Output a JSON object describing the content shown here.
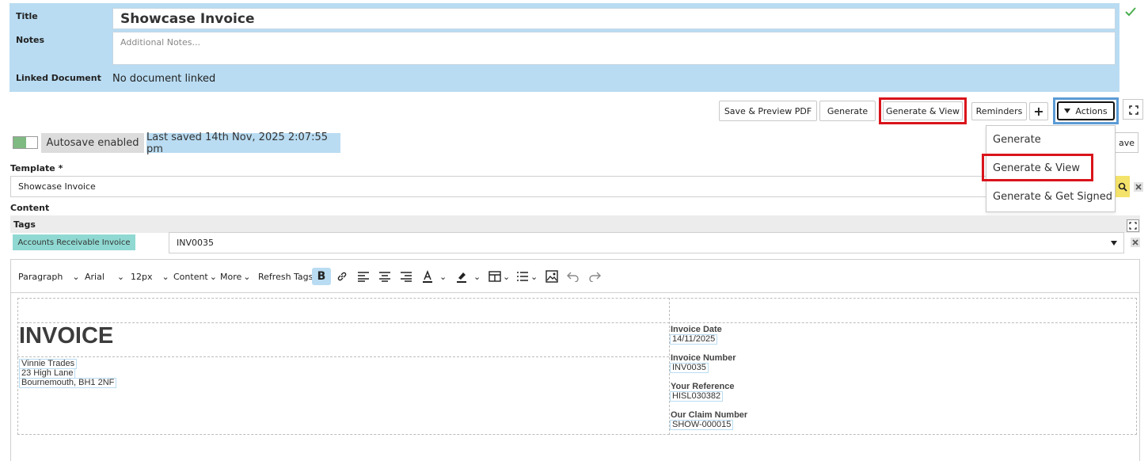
{
  "header": {
    "title_label": "Title",
    "title_value": "Showcase Invoice",
    "notes_label": "Notes",
    "notes_placeholder": "Additional Notes...",
    "linked_label": "Linked Document",
    "linked_value": "No document linked"
  },
  "toolbar": {
    "save_preview": "Save & Preview PDF",
    "generate": "Generate",
    "generate_view": "Generate & View",
    "reminders": "Reminders",
    "plus": "+",
    "actions": "Actions",
    "save_partial": "ave"
  },
  "autosave": {
    "label": "Autosave enabled",
    "last_saved": "Last saved 14th Nov, 2025 2:07:55 pm"
  },
  "actions_menu": {
    "items": [
      "Generate",
      "Generate & View",
      "Generate & Get Signed"
    ]
  },
  "template": {
    "label": "Template *",
    "value": "Showcase Invoice"
  },
  "content": {
    "label": "Content"
  },
  "tags": {
    "label": "Tags",
    "chip": "Accounts Receivable Invoice",
    "value": "INV0035"
  },
  "editor_toolbar": {
    "paragraph": "Paragraph",
    "font": "Arial",
    "size": "12px",
    "content": "Content",
    "more": "More",
    "refresh": "Refresh Tags",
    "bold": "B"
  },
  "document": {
    "title": "INVOICE",
    "address": [
      "Vinnie Trades",
      "23 High Lane",
      "Bournemouth, BH1 2NF"
    ],
    "fields": [
      {
        "label": "Invoice Date",
        "value": "14/11/2025"
      },
      {
        "label": "Invoice Number",
        "value": "INV0035"
      },
      {
        "label": "Your Reference",
        "value": "HISL030382"
      },
      {
        "label": "Our Claim Number",
        "value": "SHOW-000015"
      }
    ]
  },
  "colors": {
    "panel_blue": "#b9dcf2",
    "highlight_red": "#d9141b",
    "toggle_green": "#7fba82",
    "tag_teal": "#8fd9d2",
    "search_yellow": "#f4e36b"
  }
}
